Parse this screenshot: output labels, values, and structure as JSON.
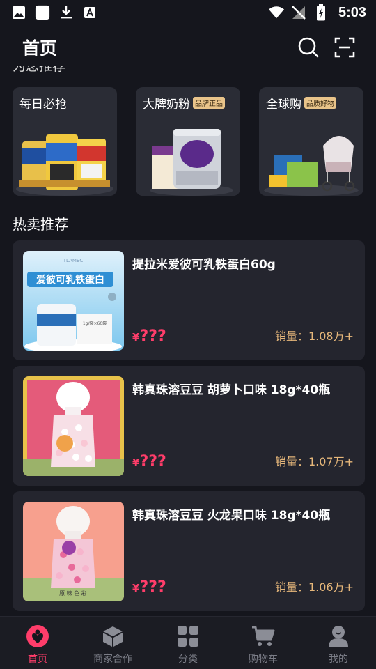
{
  "status_bar": {
    "time": "5:03"
  },
  "header": {
    "title": "首页"
  },
  "section_cut_title": "为您推荐",
  "promos": [
    {
      "title": "每日必抢",
      "tag": ""
    },
    {
      "title": "大牌奶粉",
      "tag": "品牌正品"
    },
    {
      "title": "全球购",
      "tag": "品质好物"
    }
  ],
  "hot_title": "热卖推荐",
  "products": [
    {
      "name": "提拉米爱彼可乳铁蛋白60g",
      "price_symbol": "¥",
      "price": "???",
      "sales": "销量：1.08万+"
    },
    {
      "name": "韩真珠溶豆豆 胡萝卜口味 18g*40瓶",
      "price_symbol": "¥",
      "price": "???",
      "sales": "销量：1.07万+"
    },
    {
      "name": "韩真珠溶豆豆 火龙果口味 18g*40瓶",
      "price_symbol": "¥",
      "price": "???",
      "sales": "销量：1.06万+"
    }
  ],
  "thumb_text": {
    "p1_brand": "TLAMEC",
    "p1_title": "爱彼可乳铁蛋白",
    "p1_spec": "1g/袋×60袋",
    "p3_caption": "原 味 色 彩"
  },
  "nav": [
    {
      "label": "首页",
      "active": true
    },
    {
      "label": "商家合作"
    },
    {
      "label": "分类"
    },
    {
      "label": "购物车"
    },
    {
      "label": "我的"
    }
  ],
  "colors": {
    "accent": "#ff3d6a",
    "sales": "#e6b77a",
    "background": "#15161d",
    "card": "#24252e"
  }
}
